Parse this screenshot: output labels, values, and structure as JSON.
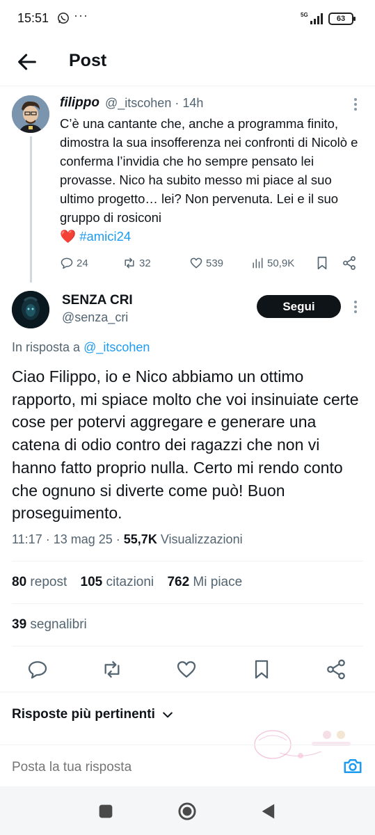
{
  "status_bar": {
    "time": "15:51",
    "more": "···",
    "network": "5G",
    "battery": "63"
  },
  "header": {
    "title": "Post"
  },
  "parent_tweet": {
    "name": "filippo",
    "handle": "@_itscohen",
    "time": "14h",
    "meta": "@_itscohen · 14h",
    "text": "C’è una cantante che, anche a programma finito, dimostra la sua insofferenza nei confronti di Nicolò e conferma l’invidia che ho sempre pensato lei provasse. Nico ha subito messo mi piace al suo ultimo progetto… lei? Non pervenuta. Lei e il suo gruppo di rosiconi",
    "heart": "❤️",
    "hashtag": "#amici24",
    "replies": "24",
    "reposts": "32",
    "likes": "539",
    "views": "50,9K"
  },
  "reply_tweet": {
    "name": "SENZA CRI",
    "handle": "@senza_cri",
    "follow_label": "Segui",
    "in_reply_prefix": "In risposta a",
    "in_reply_handle": "@_itscohen",
    "text": "Ciao Filippo, io e Nico abbiamo un ottimo rapporto, mi spiace molto che voi insinuiate certe cose per potervi aggregare e generare una catena di odio contro dei ragazzi che non vi hanno fatto proprio nulla. Certo mi rendo conto che ognuno si diverte come può! Buon proseguimento.",
    "timestamp": "11:17 · 13 mag 25 ·",
    "views_count": "55,7K",
    "views_label": "Visualizzazioni",
    "reposts_count": "80",
    "reposts_label": "repost",
    "quotes_count": "105",
    "quotes_label": "citazioni",
    "likes_count": "762",
    "likes_label": "Mi piace",
    "bookmarks_count": "39",
    "bookmarks_label": "segnalibri"
  },
  "sort": {
    "label": "Risposte più pertinenti"
  },
  "reply_bar": {
    "placeholder": "Posta la tua risposta"
  },
  "colors": {
    "accent": "#1d9bf0",
    "text": "#0f1419",
    "muted": "#536471",
    "heart": "#e0245e"
  }
}
